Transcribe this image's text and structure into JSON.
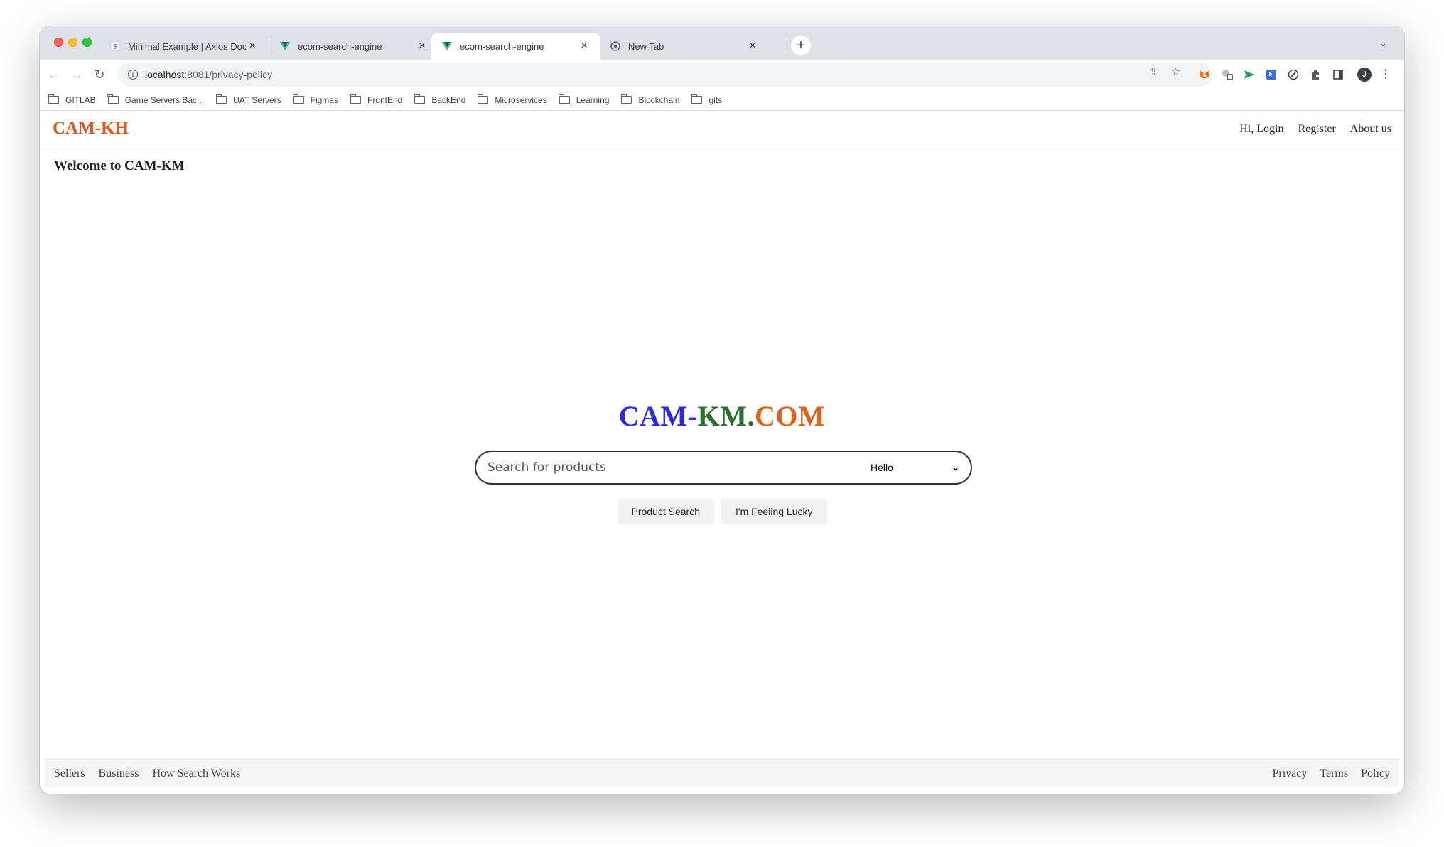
{
  "browser": {
    "tabs": [
      {
        "title": "Minimal Example | Axios Docs",
        "favicon": "axios-icon",
        "active": false
      },
      {
        "title": "ecom-search-engine",
        "favicon": "vue-icon",
        "active": false
      },
      {
        "title": "ecom-search-engine",
        "favicon": "vue-icon",
        "active": true
      },
      {
        "title": "New Tab",
        "favicon": "chrome-icon",
        "active": false
      }
    ],
    "new_tab_label": "+",
    "url_host": "localhost",
    "url_path": ":8081/privacy-policy",
    "profile_initial": "J",
    "bookmarks": [
      "GITLAB",
      "Game Servers Bac...",
      "UAT Servers",
      "Figmas",
      "FrontEnd",
      "BackEnd",
      "Microservices",
      "Learning",
      "Blockchain",
      "gits"
    ]
  },
  "site": {
    "logo": "CAM-KH",
    "nav": {
      "login": "Hi, Login",
      "register": "Register",
      "about": "About us"
    },
    "welcome": "Welcome to CAM-KM",
    "brand": {
      "part1": "CAM-",
      "part2": "KM.",
      "part3": "COM"
    },
    "search": {
      "placeholder": "Search for products",
      "selected_option": "Hello"
    },
    "buttons": {
      "search": "Product Search",
      "lucky": "I'm Feeling Lucky"
    },
    "footer": {
      "left": [
        "Sellers",
        "Business",
        "How Search Works"
      ],
      "right": [
        "Privacy",
        "Terms",
        "Policy"
      ]
    }
  },
  "colors": {
    "logo": "#e0541e",
    "brand_blue": "#2a2ae6",
    "brand_green": "#2e6e2e",
    "brand_orange": "#e0601e"
  }
}
